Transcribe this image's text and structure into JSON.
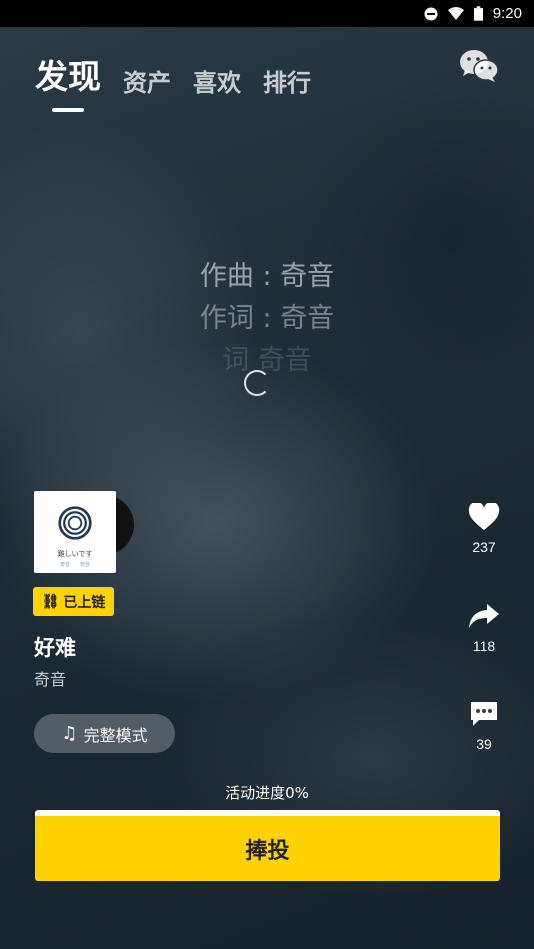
{
  "status_bar": {
    "time": "9:20"
  },
  "nav": {
    "tabs": [
      {
        "label": "发现",
        "active": true
      },
      {
        "label": "资产",
        "active": false
      },
      {
        "label": "喜欢",
        "active": false
      },
      {
        "label": "排行",
        "active": false
      }
    ],
    "wechat_icon": "wechat-icon"
  },
  "lyrics": [
    "作曲 : 奇音",
    "作词 : 奇音",
    "词 奇音"
  ],
  "album": {
    "cover_text": "難しいです",
    "cover_sub": "奇音　　奇音"
  },
  "chain_badge": "已上链",
  "song": {
    "title": "好难",
    "artist": "奇音"
  },
  "mode_button": "完整模式",
  "actions": {
    "likes": "237",
    "shares": "118",
    "comments": "39"
  },
  "progress_text": "活动进度0%",
  "invest_button": "捧投",
  "colors": {
    "accent": "#ffd200"
  }
}
